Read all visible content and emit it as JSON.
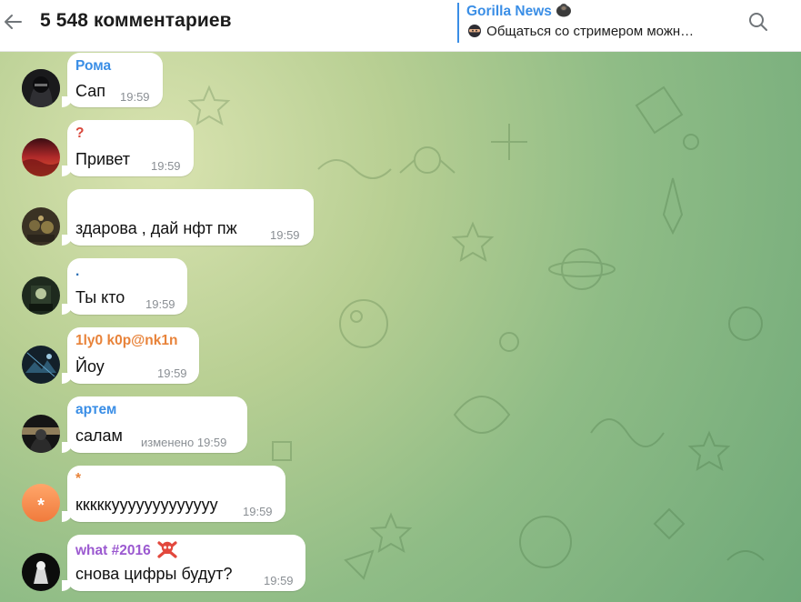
{
  "header": {
    "title": "5 548 комментариев",
    "pinned_channel": "Gorilla News",
    "pinned_message": "Общаться со стримером можн…"
  },
  "colors": {
    "accent": "#3a8ee6",
    "name_blue": "#3a8ee6",
    "name_red": "#d9493d",
    "name_orange": "#e8833a",
    "name_purple": "#9b59d0"
  },
  "messages": [
    {
      "sender": "Рома",
      "sender_color": "#3a8ee6",
      "text": "Сап",
      "time": "19:59"
    },
    {
      "sender": "?",
      "sender_color": "#d9493d",
      "text": "Привет",
      "time": "19:59"
    },
    {
      "sender": "",
      "sender_color": "#3a8ee6",
      "text": "здарова , дай нфт пж",
      "time": "19:59"
    },
    {
      "sender": ".",
      "sender_color": "#2b6fb5",
      "text": "Ты кто",
      "time": "19:59"
    },
    {
      "sender": "1ly0 k0p@nk1n",
      "sender_color": "#e8833a",
      "text": "Йоу",
      "time": "19:59"
    },
    {
      "sender": "артем",
      "sender_color": "#3a8ee6",
      "text": "салам",
      "edited": "изменено",
      "time": "19:59"
    },
    {
      "sender": "*",
      "sender_color": "#e8833a",
      "text": "кккккууууууууууууу",
      "time": "19:59",
      "avatar_letter": "*"
    },
    {
      "sender": "what #2016",
      "sender_color": "#9b59d0",
      "text": "снова цифры будут?",
      "time": "19:59"
    }
  ]
}
